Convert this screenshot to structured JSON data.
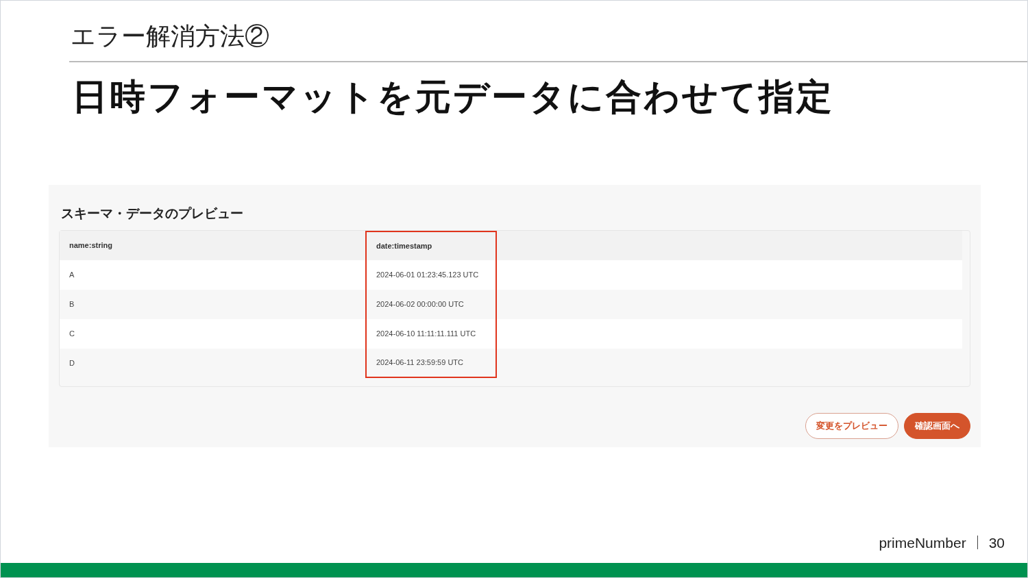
{
  "slide": {
    "section_title": "エラー解消方法②",
    "heading": "日時フォーマットを元データに合わせて指定",
    "footer": {
      "brand": "primeNumber",
      "page_number": "30"
    }
  },
  "preview": {
    "title": "スキーマ・データのプレビュー",
    "table": {
      "columns": [
        {
          "label": "name:string",
          "highlighted": false
        },
        {
          "label": "date:timestamp",
          "highlighted": true
        }
      ],
      "rows": [
        [
          "A",
          "2024-06-01 01:23:45.123 UTC"
        ],
        [
          "B",
          "2024-06-02 00:00:00 UTC"
        ],
        [
          "C",
          "2024-06-10 11:11:11.111 UTC"
        ],
        [
          "D",
          "2024-06-11 23:59:59 UTC"
        ]
      ]
    },
    "buttons": [
      {
        "label": "変更をプレビュー",
        "kind": "outline"
      },
      {
        "label": "確認画面へ",
        "kind": "filled"
      }
    ]
  }
}
